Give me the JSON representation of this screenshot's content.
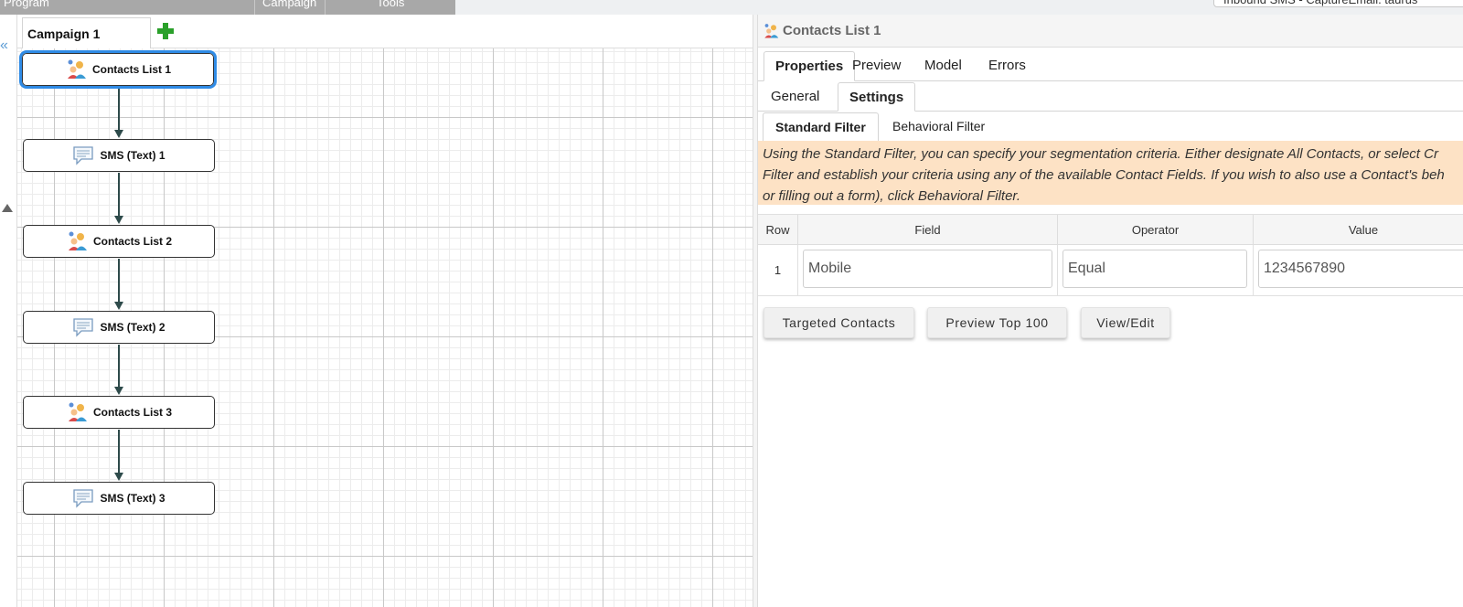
{
  "menu": {
    "items": [
      "Program",
      "Campaign",
      "Tools"
    ],
    "selector_text": "Inbound SMS - CaptureEmail. taurus"
  },
  "canvas": {
    "tab_label": "Campaign 1",
    "nodes": [
      {
        "label": "Contacts List 1",
        "icon": "contacts-list-icon",
        "selected": true
      },
      {
        "label": "SMS (Text) 1",
        "icon": "sms-speech-bubble-icon",
        "selected": false
      },
      {
        "label": "Contacts List 2",
        "icon": "contacts-list-icon",
        "selected": false
      },
      {
        "label": "SMS (Text) 2",
        "icon": "sms-speech-bubble-icon",
        "selected": false
      },
      {
        "label": "Contacts List 3",
        "icon": "contacts-list-icon",
        "selected": false
      },
      {
        "label": "SMS (Text) 3",
        "icon": "sms-speech-bubble-icon",
        "selected": false
      }
    ]
  },
  "properties": {
    "title": "Contacts List 1",
    "tabs": [
      "Properties",
      "Preview",
      "Model",
      "Errors"
    ],
    "active_tab": "Properties",
    "subtabs": [
      "General",
      "Settings"
    ],
    "active_subtab": "Settings",
    "filter_tabs": [
      "Standard Filter",
      "Behavioral Filter"
    ],
    "active_filter_tab": "Standard Filter",
    "info_lines": [
      "Using the Standard Filter, you can specify your segmentation criteria. Either designate All Contacts, or select Cr",
      "Filter and establish your criteria using any of the available Contact Fields. If you wish to also use a Contact's beh",
      "or filling out a form), click Behavioral Filter."
    ],
    "grid": {
      "headers": [
        "Row",
        "Field",
        "Operator",
        "Value"
      ],
      "rows": [
        {
          "row": "1",
          "field": "Mobile",
          "operator": "Equal",
          "value": "1234567890"
        }
      ]
    },
    "buttons": {
      "targeted": "Targeted Contacts",
      "preview": "Preview Top 100",
      "view_edit": "View/Edit"
    }
  },
  "colors": {
    "selection": "#2f8be6",
    "info_bg": "#fde2c5",
    "add_icon": "#2aa02a",
    "connector": "#2e4b4b"
  }
}
